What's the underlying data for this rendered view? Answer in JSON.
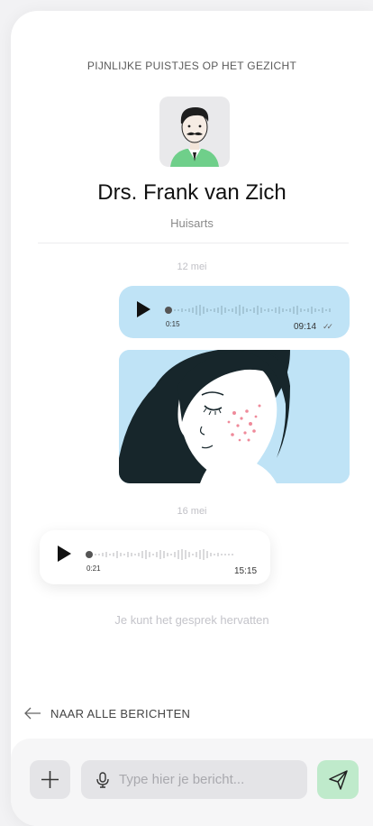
{
  "conversation": {
    "topic": "PIJNLIJKE PUISTJES OP HET GEZICHT",
    "doctor_name": "Drs. Frank van Zich",
    "doctor_role": "Huisarts"
  },
  "messages": {
    "date_1": "12 mei",
    "voice_1": {
      "duration": "0:15",
      "time": "09:14",
      "progress": 0.0
    },
    "date_2": "16 mei",
    "voice_2": {
      "duration": "0:21",
      "time": "15:15",
      "progress": 0.0
    },
    "resume_note": "Je kunt het gesprek hervatten"
  },
  "navigation": {
    "back_label": "NAAR ALLE BERICHTEN"
  },
  "composer": {
    "placeholder": "Type hier je bericht..."
  },
  "icons": [
    "doctor-avatar",
    "play-icon",
    "read-receipt-icon",
    "arrow-left-icon",
    "plus-icon",
    "microphone-icon",
    "send-icon"
  ],
  "colors": {
    "outgoing_bubble": "#bfe3f6",
    "send_button": "#bfeacb",
    "composer_background": "#f6f6f7"
  }
}
